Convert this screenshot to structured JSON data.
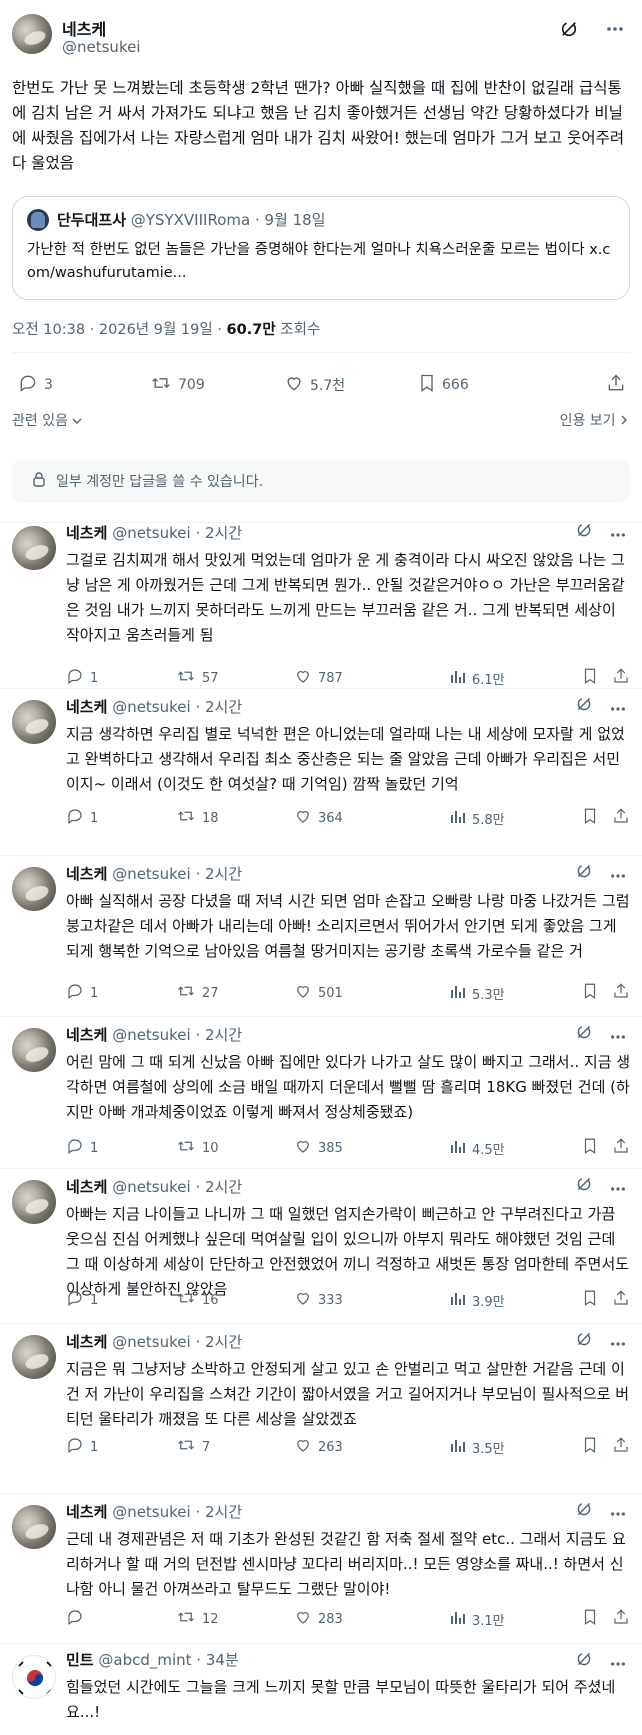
{
  "main": {
    "name": "네츠케",
    "handle": "@netsukei",
    "text": "한번도 가난 못 느껴봤는데 초등학생 2학년 땐가? 아빠 실직했을 때 집에 반찬이 없길래 급식통에 김치 남은 거 싸서 가져가도 되냐고 했음 난 김치 좋아했거든 선생님 약간 당황하셨다가 비닐에 싸줬음 집에가서 나는 자랑스럽게 엄마 내가 김치 싸왔어! 했는데 엄마가 그거 보고 웃어주려다 울었음",
    "quote": {
      "name": "단두대프사",
      "handle": "@YSYXVIIIRoma",
      "date": "· 9월 18일",
      "text": "가난한 적 한번도 없던 놈들은 가난을 증명해야 한다는게 얼마나 치욕스러운줄 모르는 법이다 x.com/washufurutamie..."
    },
    "timestamp": "오전 10:38 · 2026년 9월 19일 ·",
    "views": "60.7만",
    "views_label": "조회수",
    "stats": {
      "replies": "3",
      "retweets": "709",
      "likes": "5.7천",
      "bookmarks": "666"
    },
    "related": "관련 있음",
    "quotes_link": "인용 보기",
    "notice": "일부 계정만 답글을 쓸 수 있습니다."
  },
  "replies": [
    {
      "name": "네츠케",
      "handle": "@netsukei · 2시간",
      "text": "그걸로 김치찌개 해서 맛있게 먹었는데 엄마가 운 게 충격이라 다시 싸오진 않았음 나는 그냥 남은 게 아까웠거든 근데 그게 반복되면 뭔가.. 안될 것같은거야ㅇㅇ 가난은 부끄러움같은 것임 내가 느끼지 못하더라도 느끼게 만드는 부끄러움 같은 거.. 그게 반복되면 세상이 작아지고 움츠러들게 됨",
      "replies": "1",
      "retweets": "57",
      "likes": "787",
      "views": "6.1만"
    },
    {
      "name": "네츠케",
      "handle": "@netsukei · 2시간",
      "text": "지금 생각하면 우리집 별로 넉넉한 편은 아니었는데 얼라때 나는 내 세상에 모자랄 게 없었고 완벽하다고 생각해서 우리집 최소 중산층은 되는 줄 알았음 근데 아빠가 우리집은 서민이지~ 이래서 (이것도 한 여섯살? 때 기억임) 깜짝 놀랐던 기억",
      "replies": "1",
      "retweets": "18",
      "likes": "364",
      "views": "5.8만"
    },
    {
      "name": "네츠케",
      "handle": "@netsukei · 2시간",
      "text": "아빠 실직해서 공장 다녔을 때 저녁 시간 되면 엄마 손잡고 오빠랑 나랑 마중 나갔거든 그럼 붕고차같은 데서 아빠가 내리는데 아빠! 소리지르면서 뛰어가서 안기면 되게 좋았음 그게 되게 행복한 기억으로 남아있음 여름철 땅거미지는 공기랑 초록색 가로수들 같은 거",
      "replies": "1",
      "retweets": "27",
      "likes": "501",
      "views": "5.3만"
    },
    {
      "name": "네츠케",
      "handle": "@netsukei · 2시간",
      "text": "어린 맘에 그 때 되게 신났음 아빠 집에만 있다가 나가고 살도 많이 빠지고 그래서.. 지금 생각하면 여름철에 상의에 소금 배일 때까지 더운데서 뻘뻘 땀 흘리며 18KG 빠졌던 건데 (하지만 아빠 개과체중이었죠 이렇게 빠져서 정상체중됐죠)",
      "replies": "1",
      "retweets": "10",
      "likes": "385",
      "views": "4.5만"
    },
    {
      "name": "네츠케",
      "handle": "@netsukei · 2시간",
      "text": "아빠는 지금 나이들고 나니까 그 때 일했던 엄지손가락이 삐근하고 안 구부려진다고 가끔 웃으심 진심 어케했나 싶은데 먹여살릴 입이 있으니까 아부지 뭐라도 해야했던 것임 근데 그 때 이상하게 세상이 단단하고 안전했었어 끼니 걱정하고 새벗돈 통장 엄마한테 주면서도 이상하게 불안하진 않았음",
      "replies": "1",
      "retweets": "16",
      "likes": "333",
      "views": "3.9만"
    },
    {
      "name": "네츠케",
      "handle": "@netsukei · 2시간",
      "text": "지금은 뭐 그냥저냥 소박하고 안정되게 살고 있고 손 안벌리고 먹고 살만한 거같음 근데 이건 저 가난이 우리집을 스쳐간 기간이 짧아서였을 거고 길어지거나 부모님이 필사적으로 버티던 울타리가 깨졌음 또 다른 세상을 살았겠죠",
      "replies": "1",
      "retweets": "7",
      "likes": "263",
      "views": "3.5만"
    },
    {
      "name": "네츠케",
      "handle": "@netsukei · 2시간",
      "text": "근데 내 경제관념은 저 때 기초가 완성된 것같긴 함 저축 절세 절약 etc.. 그래서 지금도 요리하거나 할 때 거의 던전밥 센시마냥 꼬다리 버리지마..! 모든 영양소를 짜내..! 하면서 신나함 아니 물건 아껴쓰라고 탈무드도 그랬단 말이야!",
      "replies": "",
      "retweets": "12",
      "likes": "283",
      "views": "3.1만"
    }
  ],
  "last_reply": {
    "name": "민트",
    "handle": "@abcd_mint · 34분",
    "text": "힘들었던 시간에도 그늘을 크게 느끼지 못할 만큼 부모님이 따뜻한 울타리가 되어 주셨네요...!"
  }
}
